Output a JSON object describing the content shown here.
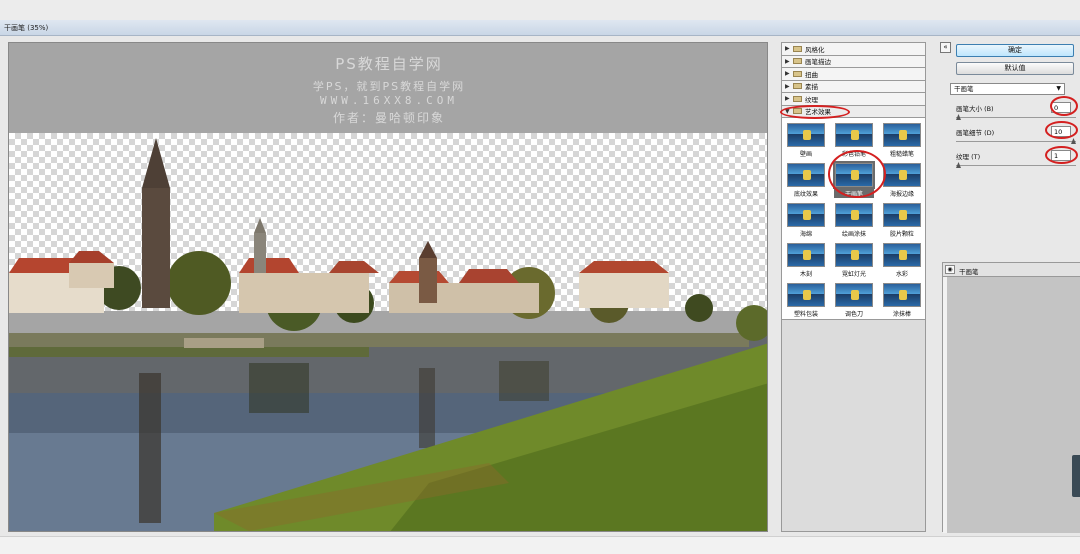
{
  "window": {
    "title": "干画笔 (35%)"
  },
  "watermark": {
    "line1": "PS教程自学网",
    "line2": "学PS，就到PS教程自学网",
    "line3": "WWW.16XX8.COM",
    "line4": "作者：曼哈顿印象"
  },
  "filter_folders": [
    {
      "label": "风格化"
    },
    {
      "label": "画笔描边"
    },
    {
      "label": "扭曲"
    },
    {
      "label": "素描"
    },
    {
      "label": "纹理"
    },
    {
      "label": "艺术效果"
    }
  ],
  "filter_thumbs": [
    {
      "label": "壁画"
    },
    {
      "label": "彩色铅笔"
    },
    {
      "label": "粗糙蜡笔"
    },
    {
      "label": "底纹效果"
    },
    {
      "label": "干画笔",
      "selected": true
    },
    {
      "label": "海报边缘"
    },
    {
      "label": "海绵"
    },
    {
      "label": "绘画涂抹"
    },
    {
      "label": "胶片颗粒"
    },
    {
      "label": "木刻"
    },
    {
      "label": "霓虹灯光"
    },
    {
      "label": "水彩"
    },
    {
      "label": "塑料包装"
    },
    {
      "label": "调色刀"
    },
    {
      "label": "涂抹棒"
    }
  ],
  "buttons": {
    "ok": "确定",
    "default": "默认值"
  },
  "filter_select": {
    "value": "干画笔"
  },
  "params": {
    "brush_size": {
      "label": "画笔大小 (B)",
      "value": "0",
      "level": 0.0
    },
    "brush_detail": {
      "label": "画笔细节 (D)",
      "value": "10",
      "level": 1.0
    },
    "texture": {
      "label": "纹理 (T)",
      "value": "1",
      "level": 0.0
    }
  },
  "layers": {
    "items": [
      {
        "label": "干画笔"
      }
    ]
  },
  "colors": {
    "annotation": "#d42020",
    "sky_check": "#d6d6d6",
    "grass": "#6f8a2a",
    "water": "#5c6f86"
  }
}
